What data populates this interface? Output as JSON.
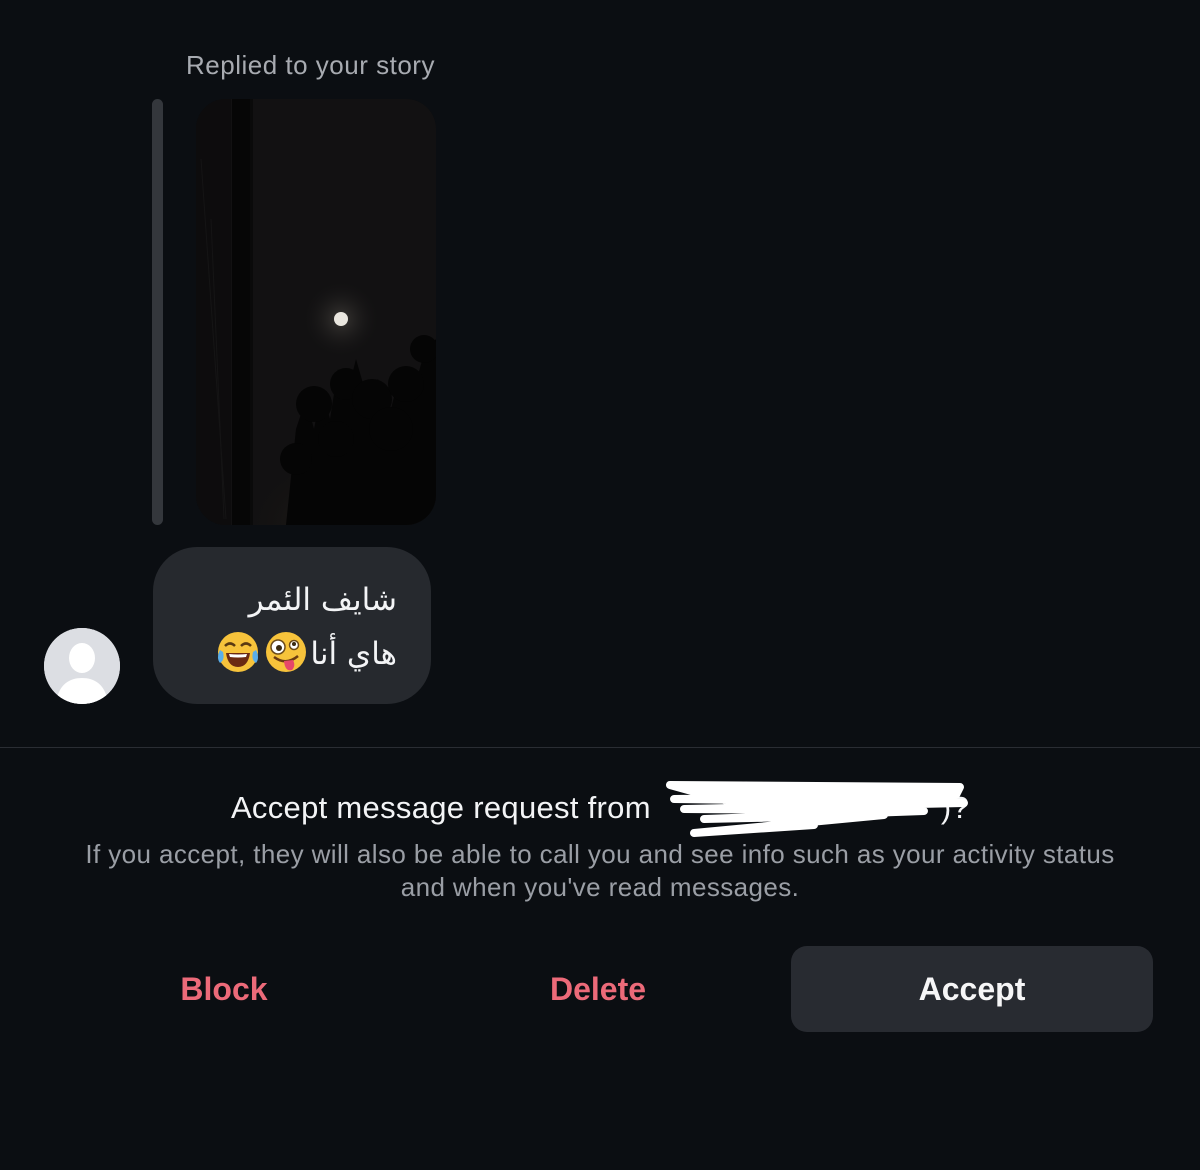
{
  "thread": {
    "replied_label": "Replied to your story",
    "story_thumbnail_icon": "story-moon-photo",
    "message_lines": [
      "شايف الئمر",
      "هاي أنا"
    ],
    "message_emojis": [
      "zany-face-emoji",
      "tears-of-joy-emoji"
    ],
    "sender_avatar_icon": "default-avatar-icon"
  },
  "request": {
    "title_prefix": "Accept message request from",
    "title_suffix": ")?",
    "description": "If you accept, they will also be able to call you and see info such as your activity status and when you've read messages."
  },
  "actions": {
    "block_label": "Block",
    "delete_label": "Delete",
    "accept_label": "Accept"
  },
  "colors": {
    "background": "#0b0e12",
    "bubble": "#26292e",
    "destructive": "#ec6a79",
    "accept_button": "#282b31",
    "secondary_text": "#9a9ea5"
  }
}
